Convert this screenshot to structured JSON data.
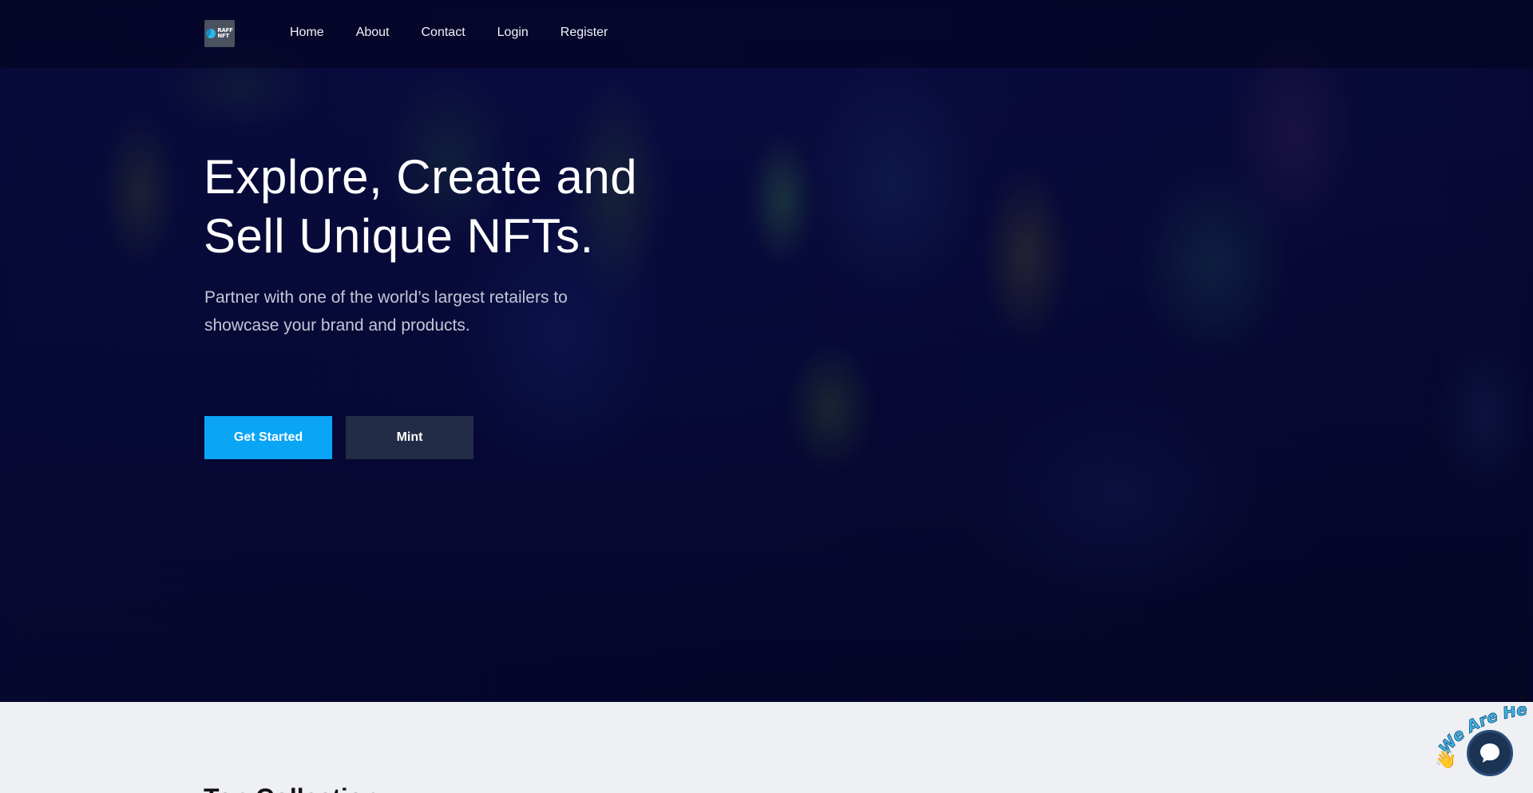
{
  "brand": {
    "logo_text_top": "RAFF",
    "logo_text_bottom": "NFT"
  },
  "nav": {
    "items": [
      {
        "label": "Home"
      },
      {
        "label": "About"
      },
      {
        "label": "Contact"
      },
      {
        "label": "Login"
      },
      {
        "label": "Register"
      }
    ]
  },
  "hero": {
    "title": "Explore, Create and Sell Unique NFTs.",
    "subtitle": "Partner with one of the world’s largest retailers to showcase your brand and products.",
    "primary_button": "Get Started",
    "secondary_button": "Mint"
  },
  "sections": {
    "top_collection_title": "Top Collection"
  },
  "chat_widget": {
    "tagline": "We Are Here!",
    "close_label": "✕",
    "wave_emoji": "👋",
    "icon": "chat-bubble-icon",
    "colors": {
      "button": "#1c3454",
      "tagline": "#3fb6e8"
    }
  },
  "colors": {
    "primary": "#0aa5f5",
    "secondary_button": "#232c47",
    "hero_bg": "#07093a"
  }
}
